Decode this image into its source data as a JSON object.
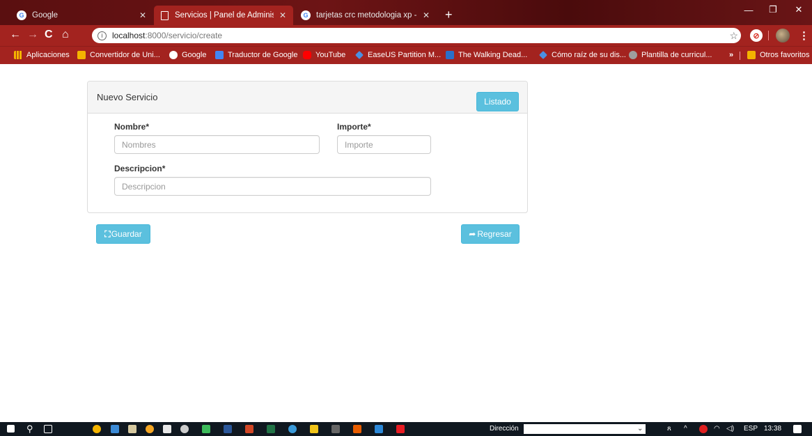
{
  "browser": {
    "tabs": [
      {
        "label": "Google",
        "icon": "google-icon"
      },
      {
        "label": "Servicios | Panel de Administraci",
        "icon": "document-icon"
      },
      {
        "label": "tarjetas crc metodologia xp - Bus",
        "icon": "google-icon"
      }
    ],
    "new_tab": "+",
    "url_host": "localhost",
    "url_path": ":8000/servicio/create",
    "bookmarks": [
      {
        "label": "Aplicaciones",
        "color": "#f4b400"
      },
      {
        "label": "Convertidor de Uni...",
        "color": "#f4b400"
      },
      {
        "label": "Google",
        "color": "#ffffff"
      },
      {
        "label": "Traductor de Google",
        "color": "#4285f4"
      },
      {
        "label": "YouTube",
        "color": "#ff0000"
      },
      {
        "label": "EaseUS Partition M...",
        "color": "#4a90e2"
      },
      {
        "label": "The Walking Dead...",
        "color": "#2a6fc9"
      },
      {
        "label": "Cómo raíz de su dis...",
        "color": "#4a90e2"
      },
      {
        "label": "Plantilla de curricul...",
        "color": "#9e9e9e"
      }
    ],
    "more_bookmarks": "»",
    "other_favorites": "Otros favoritos"
  },
  "panel": {
    "title": "Nuevo Servicio",
    "list_button": "Listado"
  },
  "form": {
    "nombre_label": "Nombre*",
    "nombre_placeholder": "Nombres",
    "importe_label": "Importe*",
    "importe_placeholder": "Importe",
    "descripcion_label": "Descripcion*",
    "descripcion_placeholder": "Descripcion"
  },
  "actions": {
    "save_button": "Guardar",
    "back_button": "Regresar"
  },
  "taskbar": {
    "address_label": "Dirección",
    "language": "ESP",
    "time": "13:38"
  },
  "colors": {
    "chrome": "#a3231f",
    "button_info": "#5bc0de"
  }
}
